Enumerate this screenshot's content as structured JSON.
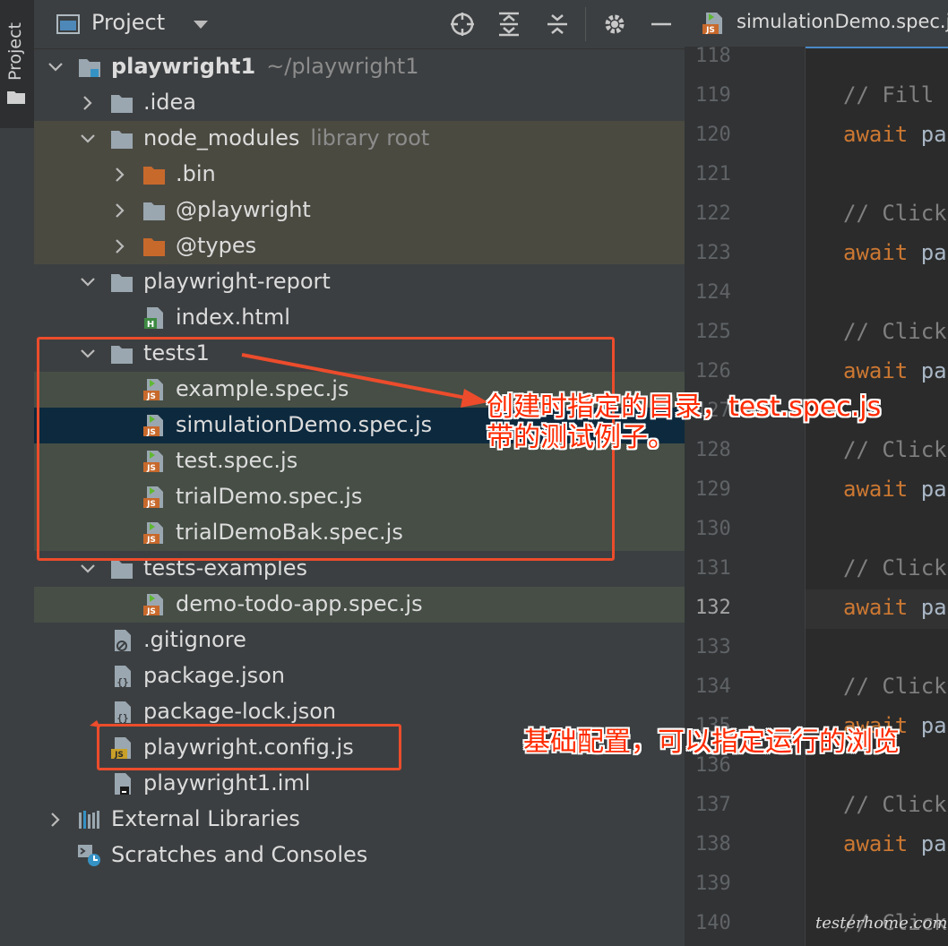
{
  "sidebar": {
    "tab_label": "Project"
  },
  "panel": {
    "title": "Project"
  },
  "tree": {
    "root_name": "playwright1",
    "root_path": "~/playwright1",
    "idea": ".idea",
    "node_modules": "node_modules",
    "node_modules_hint": "library root",
    "bin": ".bin",
    "at_playwright": "@playwright",
    "at_types": "@types",
    "report": "playwright-report",
    "index_html": "index.html",
    "tests1": "tests1",
    "example_spec": "example.spec.js",
    "simulation_spec": "simulationDemo.spec.js",
    "test_spec": "test.spec.js",
    "trial_spec": "trialDemo.spec.js",
    "trialbak_spec": "trialDemoBak.spec.js",
    "tests_examples": "tests-examples",
    "todo_spec": "demo-todo-app.spec.js",
    "gitignore": ".gitignore",
    "package_json": "package.json",
    "package_lock": "package-lock.json",
    "config": "playwright.config.js",
    "iml": "playwright1.iml",
    "external": "External Libraries",
    "scratches": "Scratches and Consoles"
  },
  "editor": {
    "tab_title": "simulationDemo.spec.js",
    "current_line": "132",
    "lines": [
      {
        "n": "118",
        "t": ""
      },
      {
        "n": "119",
        "t": "// Fill"
      },
      {
        "n": "120",
        "t": "await pa"
      },
      {
        "n": "121",
        "t": ""
      },
      {
        "n": "122",
        "t": "// Click"
      },
      {
        "n": "123",
        "t": "await pa"
      },
      {
        "n": "124",
        "t": ""
      },
      {
        "n": "125",
        "t": "// Click"
      },
      {
        "n": "126",
        "t": "await pa"
      },
      {
        "n": "127",
        "t": ""
      },
      {
        "n": "128",
        "t": "// Click"
      },
      {
        "n": "129",
        "t": "await pa"
      },
      {
        "n": "130",
        "t": ""
      },
      {
        "n": "131",
        "t": "// Click"
      },
      {
        "n": "132",
        "t": "await pa"
      },
      {
        "n": "133",
        "t": ""
      },
      {
        "n": "134",
        "t": "// Click"
      },
      {
        "n": "135",
        "t": "await pa"
      },
      {
        "n": "136",
        "t": ""
      },
      {
        "n": "137",
        "t": "// Click"
      },
      {
        "n": "138",
        "t": "await pa"
      },
      {
        "n": "139",
        "t": ""
      },
      {
        "n": "140",
        "t": "// Click"
      }
    ]
  },
  "annotations": {
    "tests_line1": "创建时指定的目录，test.spec.js",
    "tests_line2": "带的测试例子。",
    "config_note": "基础配置，可以指定运行的浏览"
  },
  "watermark": "testerhome.com",
  "colors": {
    "annotation_red": "#ff2a00",
    "box_red": "#ec4c2c",
    "selection": "#0d293e",
    "folder_orange": "#c8692c"
  }
}
